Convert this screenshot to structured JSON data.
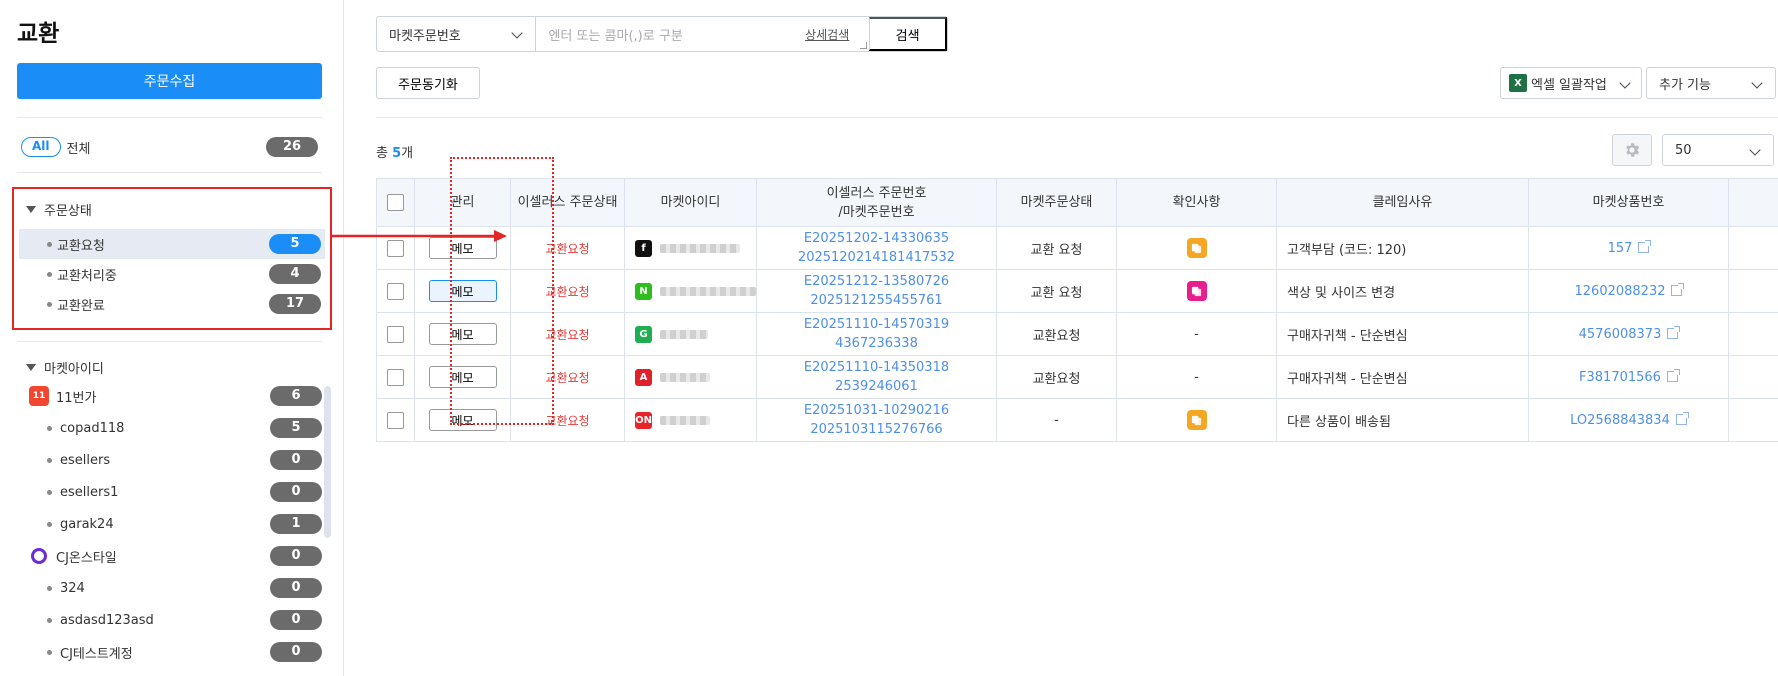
{
  "page_title": "교환",
  "collect_button": "주문수집",
  "all": {
    "chip": "All",
    "label": "전체",
    "count": "26"
  },
  "order_status": {
    "heading": "주문상태",
    "items": [
      {
        "label": "교환요청",
        "count": "5",
        "active": true
      },
      {
        "label": "교환처리중",
        "count": "4"
      },
      {
        "label": "교환완료",
        "count": "17"
      }
    ]
  },
  "market_ids": {
    "heading": "마켓아이디",
    "groups": [
      {
        "label": "11번가",
        "count": "6",
        "icon": "11st-logo"
      },
      {
        "label": "copad118",
        "count": "5"
      },
      {
        "label": "esellers",
        "count": "0"
      },
      {
        "label": "esellers1",
        "count": "0"
      },
      {
        "label": "garak24",
        "count": "1"
      },
      {
        "label": "CJ온스타일",
        "count": "0",
        "icon": "cj-onstyle-logo"
      },
      {
        "label": "324",
        "count": "0"
      },
      {
        "label": "asdasd123asd",
        "count": "0"
      },
      {
        "label": "CJ테스트계정",
        "count": "0"
      }
    ]
  },
  "search": {
    "select_value": "마켓주문번호",
    "placeholder": "엔터 또는 콤마(,)로 구분",
    "detail_link": "상세검색",
    "button": "검색"
  },
  "toolbar": {
    "sync_button": "주문동기화",
    "excel_button": "엑셀 일괄작업",
    "more_button": "추가 기능",
    "page_size": "50"
  },
  "total": {
    "prefix": "총 ",
    "count": "5",
    "suffix": "개"
  },
  "table": {
    "headers": [
      "관리",
      "이셀러스 주문상태",
      "마켓아이디",
      "이셀러스 주문번호\n/마켓주문번호",
      "마켓주문상태",
      "확인사항",
      "클레임사유",
      "마켓상품번호"
    ],
    "rows": [
      {
        "memo": "메모",
        "status": "교환요청",
        "market_logo": "f",
        "market_color": "#111111",
        "order1": "E20251202-14330635",
        "order2": "2025120214181417532",
        "market_status": "교환 요청",
        "check": "orange",
        "reason": "고객부담 (코드: 120)",
        "product": "157"
      },
      {
        "memo": "메모",
        "status": "교환요청",
        "market_logo": "N",
        "market_color": "#2dbe1e",
        "order1": "E20251212-13580726",
        "order2": "2025121255455761",
        "market_status": "교환 요청",
        "check": "pink",
        "reason": "색상 및 사이즈 변경",
        "product": "12602088232"
      },
      {
        "memo": "메모",
        "status": "교환요청",
        "market_logo": "G",
        "market_color": "#1fae52",
        "order1": "E20251110-14570319",
        "order2": "4367236338",
        "market_status": "교환요청",
        "check": "-",
        "reason": "구매자귀책 - 단순변심",
        "product": "4576008373"
      },
      {
        "memo": "메모",
        "status": "교환요청",
        "market_logo": "A",
        "market_color": "#e0212b",
        "order1": "E20251110-14350318",
        "order2": "2539246061",
        "market_status": "교환요청",
        "check": "-",
        "reason": "구매자귀책 - 단순변심",
        "product": "F381701566"
      },
      {
        "memo": "메모",
        "status": "교환요청",
        "market_logo": "ON",
        "market_color": "#e8232a",
        "order1": "E20251031-10290216",
        "order2": "2025103115276766",
        "market_status": "-",
        "check": "orange",
        "reason": "다른 상품이 배송됨",
        "product": "LO2568843834"
      }
    ]
  }
}
